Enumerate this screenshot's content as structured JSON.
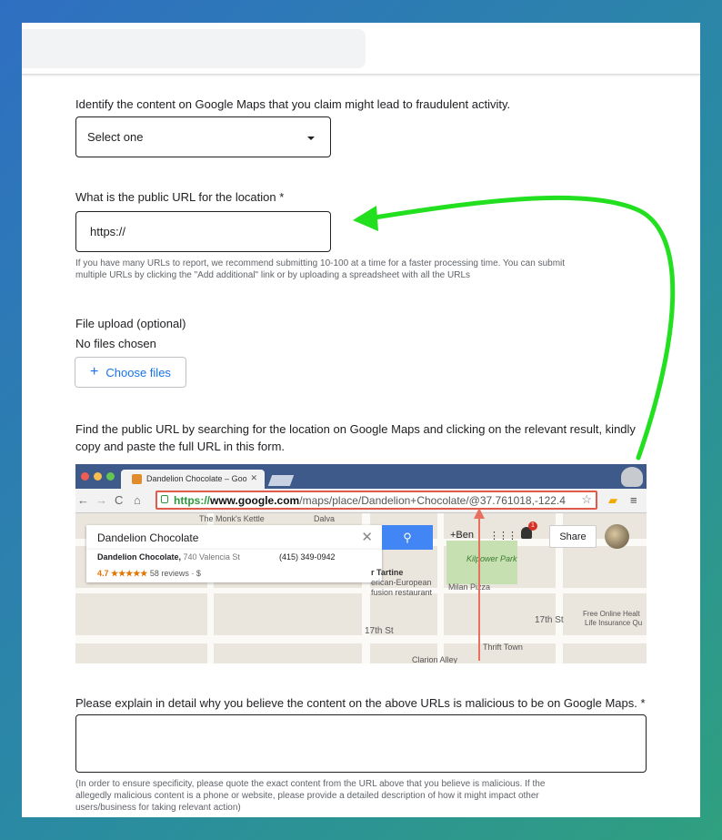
{
  "form": {
    "q1_label": "Identify the content on Google Maps that you claim might lead to fraudulent activity.",
    "q1_select_value": "Select one",
    "q2_label": "What is the public URL for the location *",
    "q2_value": "https://",
    "q2_helper_line1": "If you have many URLs to report, we recommend submitting 10-100 at a time for a faster processing time. You can submit",
    "q2_helper_line2": "multiple URLs by clicking the \"Add additional\" link or by uploading a spreadsheet with all the URLs",
    "upload_label": "File upload (optional)",
    "upload_status": "No files chosen",
    "choose_files_label": "Choose files",
    "find_url_line1": "Find the public URL by searching for the location on Google Maps and clicking on the relevant result, kindly",
    "find_url_line2": "copy and paste the full URL in this form.",
    "q3_label": "Please explain in detail why you believe the content on the above URLs is malicious to be on Google Maps. *",
    "q3_value": "",
    "q3_helper_line1": "(In order to ensure specificity, please quote the exact content from the URL above that you believe is malicious. If the",
    "q3_helper_line2": "allegedly malicious content is a phone or website, please provide a detailed description of how it might impact other",
    "q3_helper_line3": "users/business for taking relevant action)"
  },
  "example_screenshot": {
    "tab_title": "Dandelion Chocolate – Goo",
    "url_scheme": "https://",
    "url_domain": "www.google.com",
    "url_path": "/maps/place/Dandelion+Chocolate/@37.761018,-122.4",
    "search_value": "Dandelion Chocolate",
    "suggestion_name": "Dandelion Chocolate,",
    "suggestion_address": " 740 Valencia St",
    "suggestion_phone": "(415) 349-0942",
    "suggestion_rating": "4.7 ★★★★★",
    "suggestion_reviews": "58 reviews · $",
    "user_label": "+Ben",
    "notification_count": "1",
    "share_label": "Share",
    "map_labels": {
      "kettle": "The Monk's Kettle",
      "dalva": "Dalva",
      "kilpower": "Kilpower Park",
      "tartine": "r Tartine",
      "tartine2": "erican-European",
      "tartine3": "fusion restaurant",
      "milan": "Milan Pizza",
      "st17a": "17th St",
      "st17b": "17th St",
      "free": "Free Online Healt",
      "life": "Life Insurance Qu",
      "thrift": "Thrift Town",
      "clarion": "Clarion Alley"
    }
  },
  "colors": {
    "annotation_arrow": "#22e01f",
    "url_highlight": "#e05b4a",
    "link_blue": "#1a73e8"
  }
}
